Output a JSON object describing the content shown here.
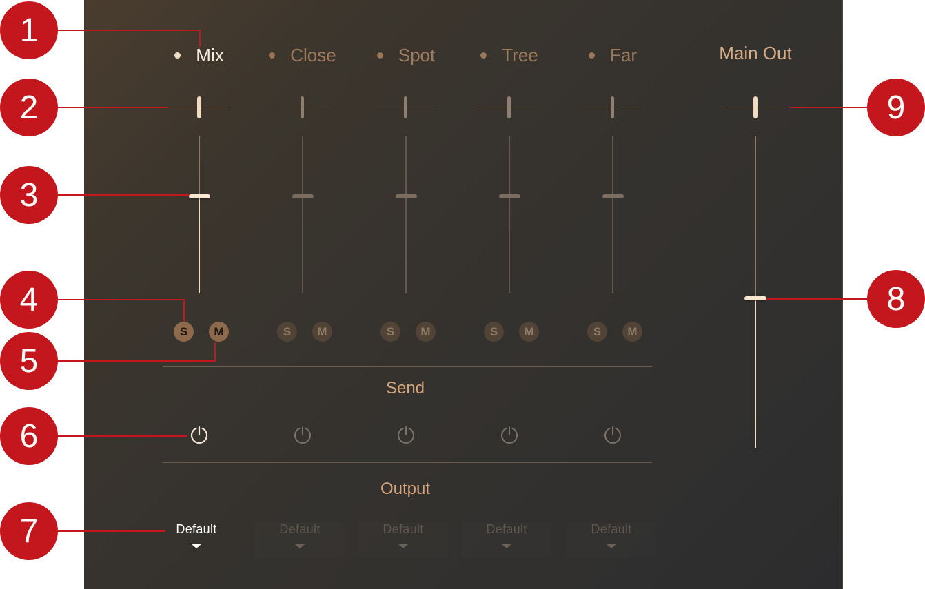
{
  "colors": {
    "accent": "#d4a47c",
    "callout": "#c4171d",
    "active_text": "#f6eadc",
    "inactive_text": "#9c7b5f"
  },
  "channels": [
    {
      "name": "Mix",
      "active": true,
      "solo_label": "S",
      "mute_label": "M",
      "output": "Default",
      "fader_level": 0.62,
      "pan": 0.0
    },
    {
      "name": "Close",
      "active": false,
      "solo_label": "S",
      "mute_label": "M",
      "output": "Default",
      "fader_level": 0.62,
      "pan": 0.0
    },
    {
      "name": "Spot",
      "active": false,
      "solo_label": "S",
      "mute_label": "M",
      "output": "Default",
      "fader_level": 0.62,
      "pan": 0.0
    },
    {
      "name": "Tree",
      "active": false,
      "solo_label": "S",
      "mute_label": "M",
      "output": "Default",
      "fader_level": 0.62,
      "pan": 0.0
    },
    {
      "name": "Far",
      "active": false,
      "solo_label": "S",
      "mute_label": "M",
      "output": "Default",
      "fader_level": 0.62,
      "pan": 0.0
    }
  ],
  "main_out": {
    "label": "Main Out",
    "fader_level": 0.48,
    "pan": 0.0
  },
  "sections": {
    "send": "Send",
    "output": "Output"
  },
  "callouts": [
    "1",
    "2",
    "3",
    "4",
    "5",
    "6",
    "7",
    "8",
    "9"
  ]
}
